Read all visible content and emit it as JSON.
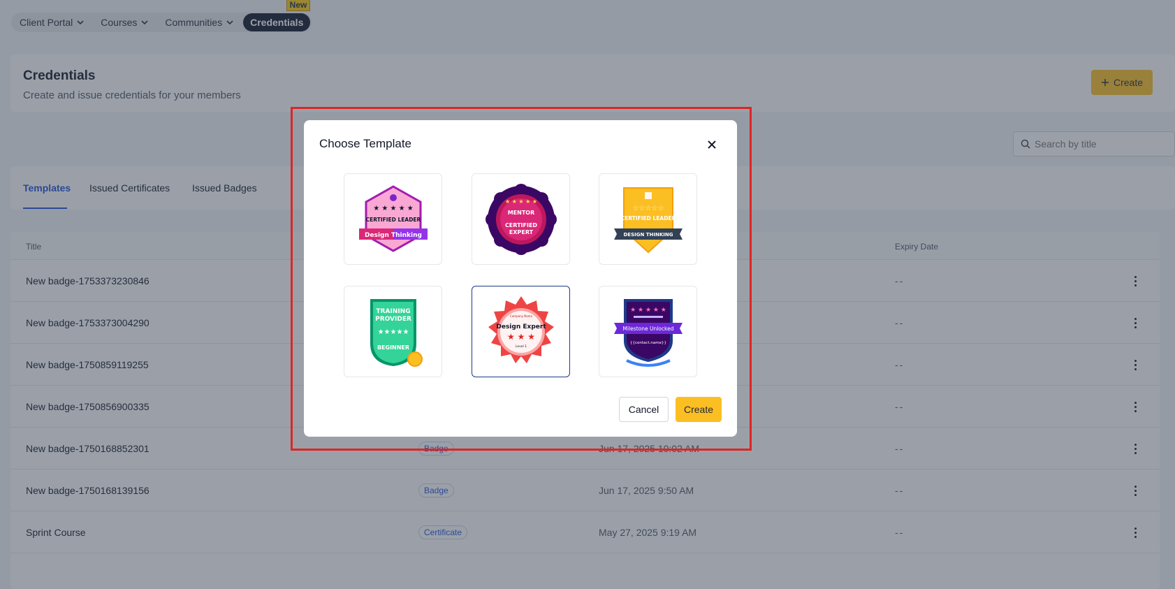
{
  "nav": {
    "items": [
      {
        "label": "Client Portal",
        "dropdown": true
      },
      {
        "label": "Courses",
        "dropdown": true
      },
      {
        "label": "Communities",
        "dropdown": true
      },
      {
        "label": "Credentials",
        "dropdown": false,
        "active": true
      }
    ],
    "new_badge": "New"
  },
  "header": {
    "title": "Credentials",
    "subtitle": "Create and issue credentials for your members",
    "create_label": "Create"
  },
  "search": {
    "placeholder": "Search by title"
  },
  "tabs": [
    {
      "label": "Templates",
      "active": true
    },
    {
      "label": "Issued Certificates"
    },
    {
      "label": "Issued Badges"
    }
  ],
  "table": {
    "headers": {
      "title": "Title",
      "expiry": "Expiry Date"
    },
    "rows": [
      {
        "title": "New badge-1753373230846",
        "type": "",
        "date": "",
        "expiry": "--"
      },
      {
        "title": "New badge-1753373004290",
        "type": "",
        "date": "",
        "expiry": "--"
      },
      {
        "title": "New badge-1750859119255",
        "type": "",
        "date": "",
        "expiry": "--"
      },
      {
        "title": "New badge-1750856900335",
        "type": "",
        "date": "",
        "expiry": "--"
      },
      {
        "title": "New badge-1750168852301",
        "type": "Badge",
        "date": "Jun 17, 2025 10:02 AM",
        "expiry": "--"
      },
      {
        "title": "New badge-1750168139156",
        "type": "Badge",
        "date": "Jun 17, 2025 9:50 AM",
        "expiry": "--"
      },
      {
        "title": "Sprint Course",
        "type": "Certificate",
        "date": "May 27, 2025 9:19 AM",
        "expiry": "--"
      }
    ]
  },
  "modal": {
    "title": "Choose Template",
    "cancel_label": "Cancel",
    "create_label": "Create",
    "templates": [
      {
        "name": "certified-leader-design-thinking",
        "top": "CERTIFIED LEADER",
        "ribbon": "Design Thinking"
      },
      {
        "name": "mentor-certified-expert",
        "top": "MENTOR",
        "line1": "CERTIFIED",
        "line2": "EXPERT"
      },
      {
        "name": "certified-leader-design-thinking-gold",
        "top": "CERTIFIED LEADER",
        "ribbon": "DESIGN THINKING"
      },
      {
        "name": "training-provider-beginner",
        "line1": "TRAINING",
        "line2": "PROVIDER",
        "bottom": "BEGINNER"
      },
      {
        "name": "design-expert-level-1",
        "top": "Company Name",
        "main": "Design Expert",
        "bottom": "Level 1",
        "selected": true
      },
      {
        "name": "milestone-unlocked",
        "ribbon": "Milestone Unlocked",
        "bottom": "{{contact.name}}"
      }
    ]
  },
  "colors": {
    "accent": "#fbbf24",
    "primary_blue": "#1d4ed8",
    "nav_active": "#0f172a",
    "highlight": "#dc2626"
  }
}
